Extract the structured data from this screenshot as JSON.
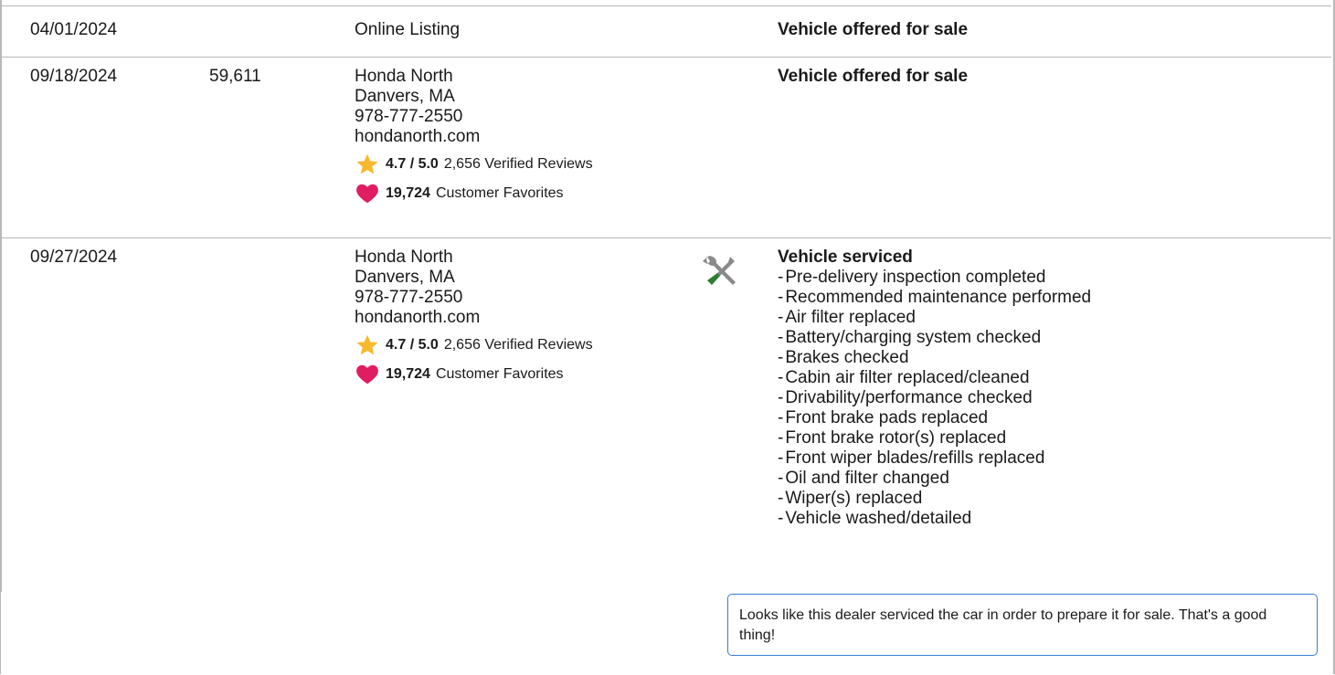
{
  "rows": [
    {
      "date": "04/01/2024",
      "mileage": "",
      "source": {
        "lines": [
          "Online Listing"
        ]
      },
      "comment_title": "Vehicle offered for sale"
    },
    {
      "date": "09/18/2024",
      "mileage": "59,611",
      "source": {
        "lines": [
          "Honda North",
          "Danvers, MA",
          "978-777-2550",
          "hondanorth.com"
        ],
        "rating_value": "4.7 / 5.0",
        "rating_text": "2,656 Verified Reviews",
        "favorites_value": "19,724",
        "favorites_text": "Customer Favorites"
      },
      "comment_title": "Vehicle offered for sale"
    },
    {
      "date": "09/27/2024",
      "mileage": "",
      "source": {
        "lines": [
          "Honda North",
          "Danvers, MA",
          "978-777-2550",
          "hondanorth.com"
        ],
        "rating_value": "4.7 / 5.0",
        "rating_text": "2,656 Verified Reviews",
        "favorites_value": "19,724",
        "favorites_text": "Customer Favorites"
      },
      "comment_title": "Vehicle serviced",
      "service_icon": "wrench-screwdriver-icon",
      "service_items": [
        "Pre-delivery inspection completed",
        "Recommended maintenance performed",
        "Air filter replaced",
        "Battery/charging system checked",
        "Brakes checked",
        "Cabin air filter replaced/cleaned",
        "Drivability/performance checked",
        "Front brake pads replaced",
        "Front brake rotor(s) replaced",
        "Front wiper blades/refills replaced",
        "Oil and filter changed",
        "Wiper(s) replaced",
        "Vehicle washed/detailed"
      ]
    }
  ],
  "tip_text": "Looks like this dealer serviced the car in order to prepare it for sale. That's a good thing!",
  "colors": {
    "star": "#f7b92b",
    "heart": "#e11d62",
    "tip_border": "#3a7bd5",
    "divider": "#b8b8b8",
    "screwdriver": "#2e7d32",
    "wrench": "#8a8a8a"
  }
}
